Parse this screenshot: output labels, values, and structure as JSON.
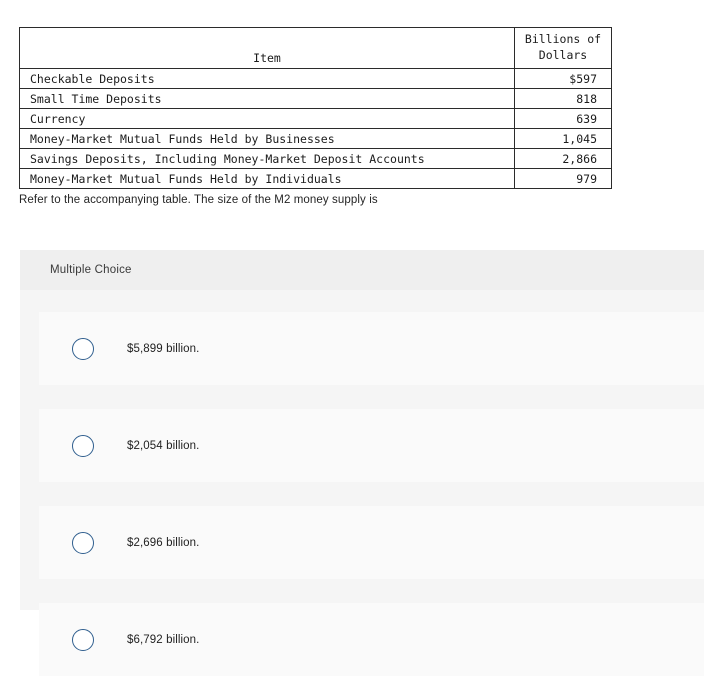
{
  "table": {
    "headers": {
      "item": "Item",
      "unit_line1": "Billions of",
      "unit_line2": "Dollars"
    },
    "rows": [
      {
        "item": "Checkable Deposits",
        "value": "$597"
      },
      {
        "item": "Small Time Deposits",
        "value": "818"
      },
      {
        "item": "Currency",
        "value": "639"
      },
      {
        "item": "Money-Market Mutual Funds Held by Businesses",
        "value": "1,045"
      },
      {
        "item": "Savings Deposits, Including Money-Market Deposit Accounts",
        "value": "2,866"
      },
      {
        "item": "Money-Market Mutual Funds Held by Individuals",
        "value": "979"
      }
    ]
  },
  "question": {
    "prompt": "Refer to the accompanying table. The size of the M2 money supply is"
  },
  "answer_card": {
    "type_label": "Multiple Choice",
    "options": [
      {
        "label": "$5,899 billion.",
        "icon": "radio-unchecked-icon"
      },
      {
        "label": "$2,054 billion.",
        "icon": "radio-unchecked-icon"
      },
      {
        "label": "$2,696 billion.",
        "icon": "radio-unchecked-icon"
      },
      {
        "label": "$6,792 billion.",
        "icon": "radio-unchecked-icon"
      }
    ]
  },
  "colors": {
    "radio_border": "#2f5e8e",
    "card_background": "#f5f5f5",
    "card_header_background": "#efefef",
    "option_row_background": "#fafafa",
    "table_border": "#2b2b2b"
  }
}
